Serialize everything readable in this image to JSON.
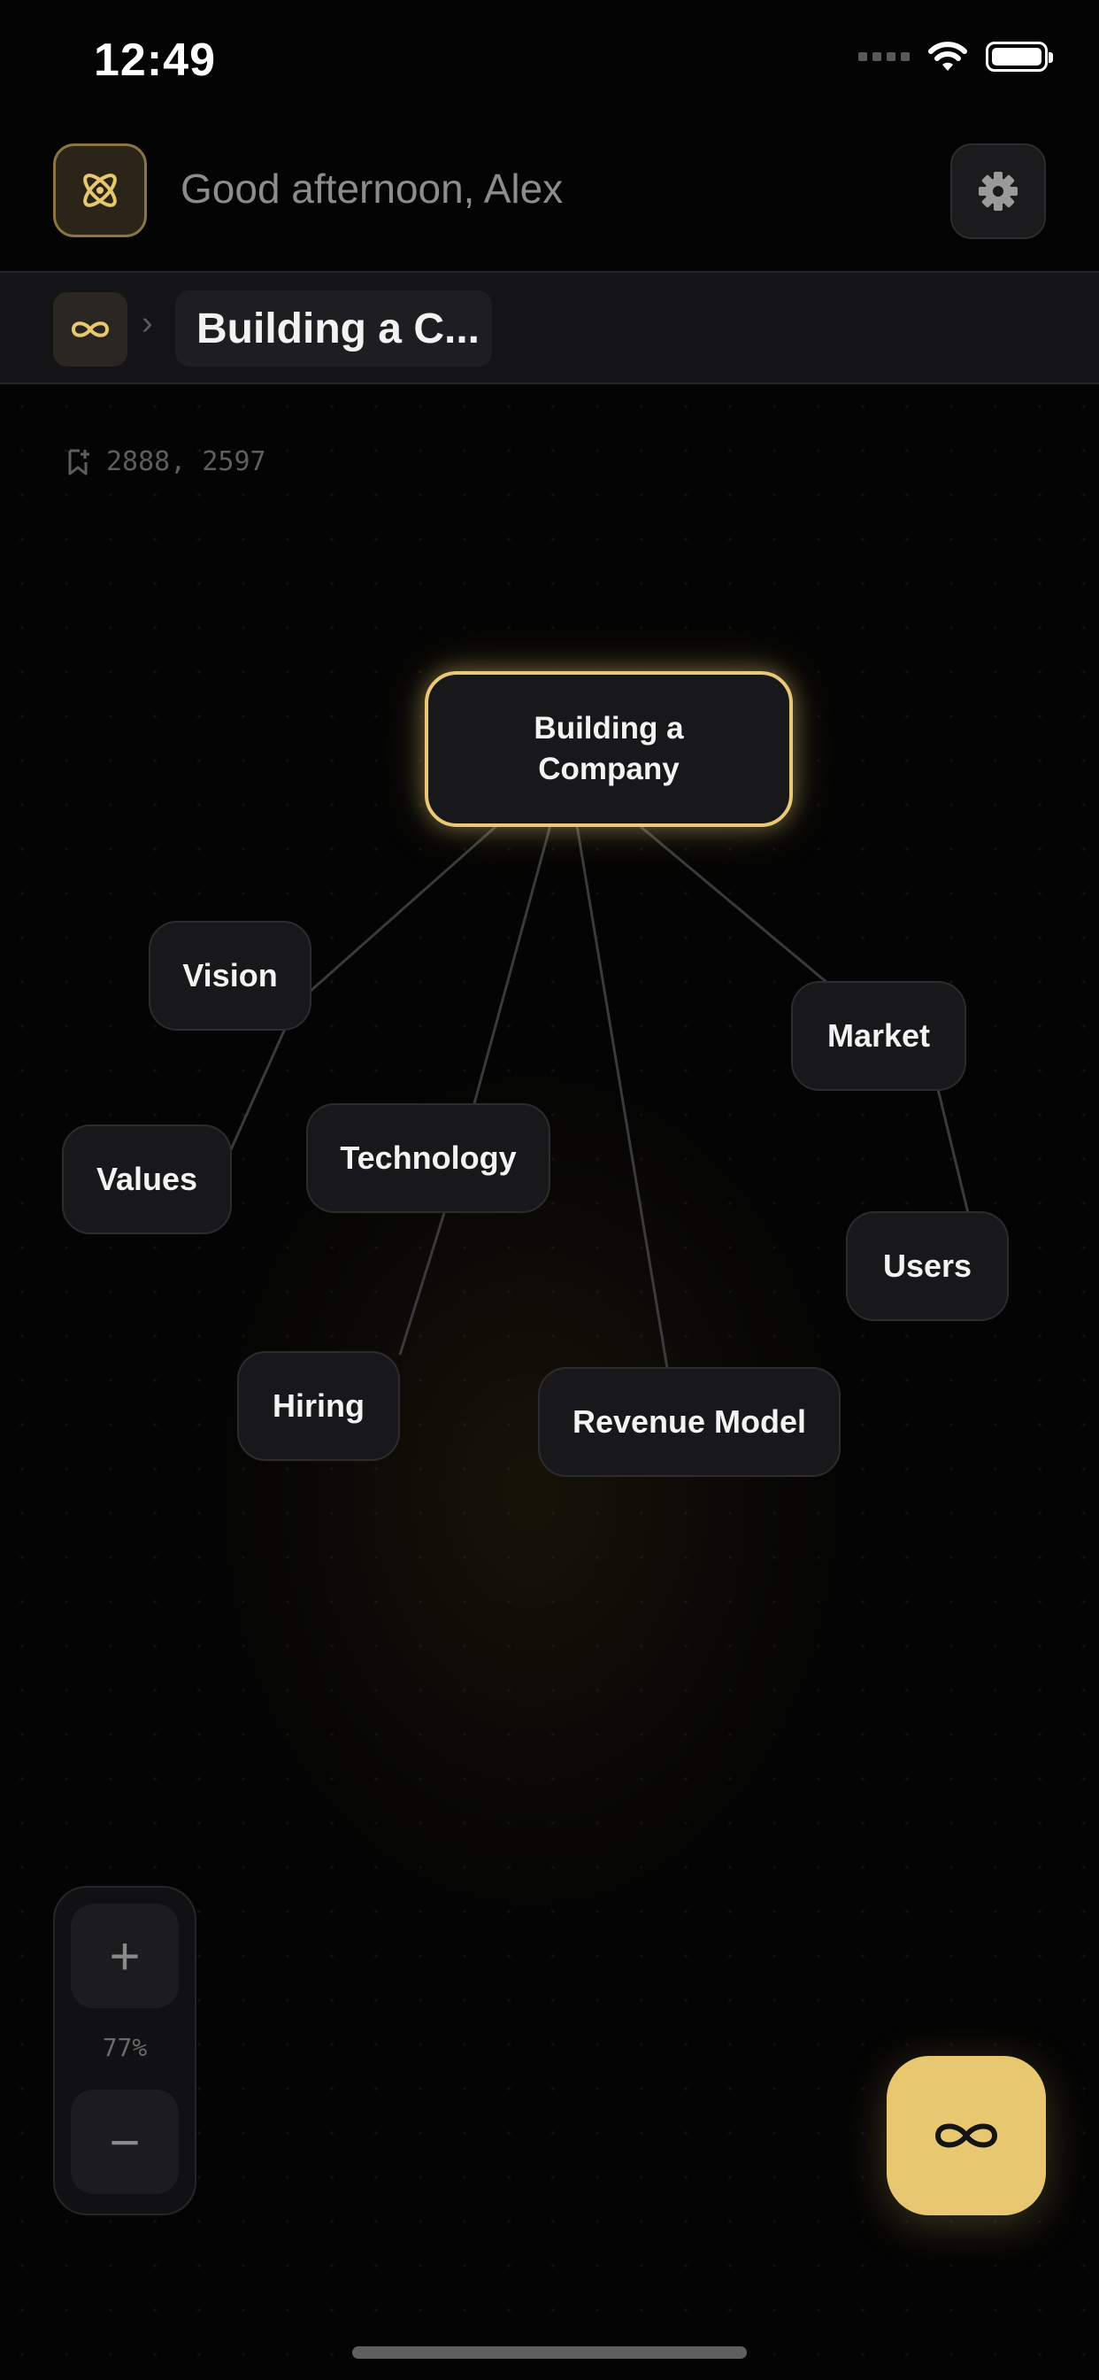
{
  "status_bar": {
    "time": "12:49"
  },
  "header": {
    "greeting": "Good afternoon, Alex",
    "logo_icon": "atom-icon",
    "settings_icon": "gear-icon"
  },
  "breadcrumb": {
    "home_icon": "infinity-icon",
    "separator": "›",
    "current": "Building a C..."
  },
  "canvas": {
    "coordinates": "2888, 2597",
    "zoom_level": "77%",
    "zoom_in_label": "+",
    "zoom_out_label": "−"
  },
  "mind_map": {
    "root": "Building a Company",
    "root_lines": [
      "Building a",
      "Company"
    ],
    "nodes": {
      "vision": "Vision",
      "values": "Values",
      "technology": "Technology",
      "hiring": "Hiring",
      "market": "Market",
      "users": "Users",
      "revenue_model": "Revenue Model"
    }
  },
  "colors": {
    "accent": "#e8c771",
    "background": "#040404",
    "node_fill": "#18181a"
  },
  "fab": {
    "icon": "infinity-icon"
  }
}
